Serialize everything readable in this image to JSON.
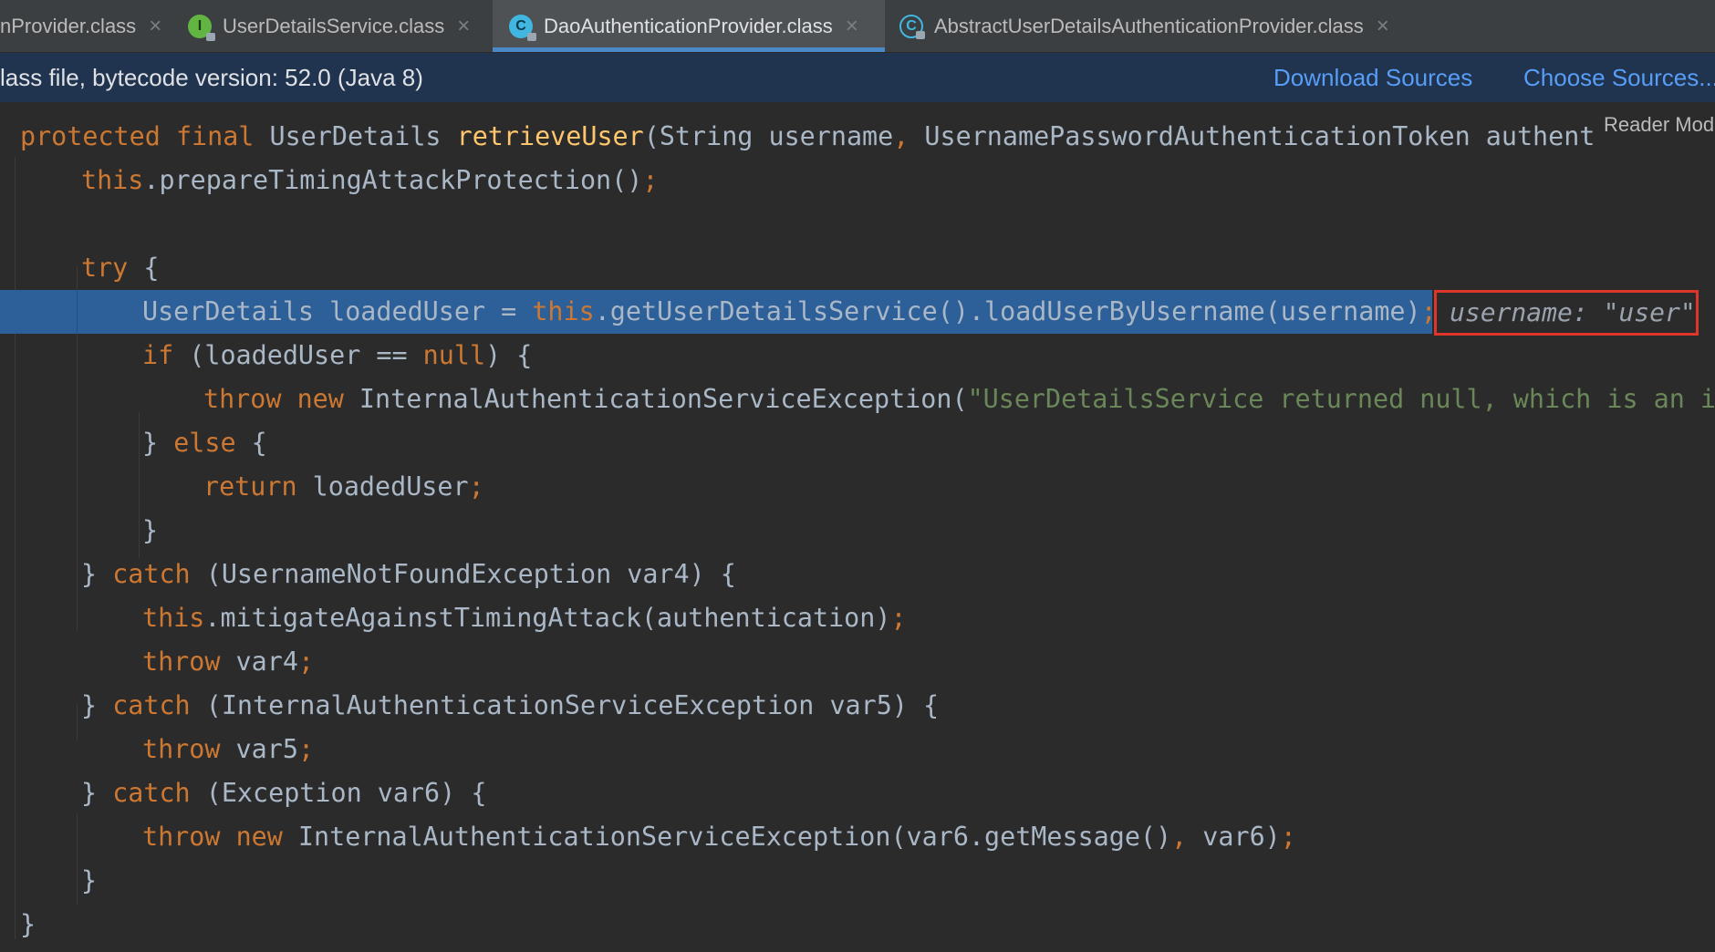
{
  "tabs": [
    {
      "label": "nProvider.class",
      "icon": "none",
      "active": false
    },
    {
      "label": "UserDetailsService.class",
      "icon": "interface-icon",
      "active": false
    },
    {
      "label": "DaoAuthenticationProvider.class",
      "icon": "class-icon",
      "active": true
    },
    {
      "label": "AbstractUserDetailsAuthenticationProvider.class",
      "icon": "abstract-class-icon",
      "active": false
    }
  ],
  "close_glyph": "×",
  "banner": {
    "message": "lass file, bytecode version: 52.0 (Java 8)",
    "download_sources": "Download Sources",
    "choose_sources": "Choose Sources..."
  },
  "reader_mode": "Reader Mod",
  "code": {
    "l1": {
      "a": "protected",
      "b": " ",
      "c": "final",
      "d": " UserDetails ",
      "e": "retrieveUser",
      "f": "(String username",
      "g": ",",
      "h": " UsernamePasswordAuthenticationToken authent"
    },
    "l2": {
      "a": "this",
      "b": ".prepareTimingAttackProtection()",
      "c": ";"
    },
    "l4": {
      "a": "try",
      "b": " {"
    },
    "l5": {
      "a": "UserDetails loadedUser = ",
      "b": "this",
      "c": ".getUserDetailsService().loadUserByUsername(username)",
      "d": ";"
    },
    "l6": {
      "a": "if",
      "b": " (loadedUser == ",
      "c": "null",
      "d": ") {"
    },
    "l7": {
      "a": "throw",
      "b": " ",
      "c": "new",
      "d": " InternalAuthenticationServiceException(",
      "e": "\"UserDetailsService returned null, which is an int"
    },
    "l8": {
      "a": "} ",
      "b": "else",
      "c": " {"
    },
    "l9": {
      "a": "return",
      "b": " loadedUser",
      "c": ";"
    },
    "l10": {
      "a": "}"
    },
    "l11": {
      "a": "} ",
      "b": "catch",
      "c": " (UsernameNotFoundException var4) {"
    },
    "l12": {
      "a": "this",
      "b": ".mitigateAgainstTimingAttack(authentication)",
      "c": ";"
    },
    "l13": {
      "a": "throw",
      "b": " var4",
      "c": ";"
    },
    "l14": {
      "a": "} ",
      "b": "catch",
      "c": " (InternalAuthenticationServiceException var5) {"
    },
    "l15": {
      "a": "throw",
      "b": " var5",
      "c": ";"
    },
    "l16": {
      "a": "} ",
      "b": "catch",
      "c": " (Exception var6) {"
    },
    "l17": {
      "a": "throw",
      "b": " ",
      "c": "new",
      "d": " InternalAuthenticationServiceException(var6.getMessage()",
      "e": ",",
      "f": " var6)",
      "g": ";"
    },
    "l18": {
      "a": "}"
    },
    "l19": {
      "a": "}"
    }
  },
  "inlay_hint": "username: \"user\"",
  "colors": {
    "keyword": "#cc7832",
    "function": "#ffc66d",
    "string": "#6a8759",
    "highlight": "#2d5f99",
    "inlay_border": "#e0352b",
    "link": "#589df6"
  }
}
